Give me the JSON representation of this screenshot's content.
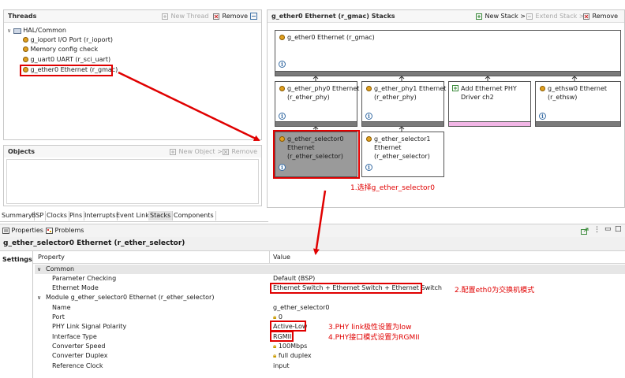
{
  "threads": {
    "title": "Threads",
    "new_thread": "New Thread",
    "remove": "Remove",
    "tree": {
      "root": "HAL/Common",
      "items": [
        "g_ioport I/O Port (r_ioport)",
        "Memory config check",
        "g_uart0 UART (r_sci_uart)",
        "g_ether0 Ethernet (r_gmac)"
      ]
    }
  },
  "objects": {
    "title": "Objects",
    "new_object": "New Object >",
    "remove": "Remove"
  },
  "stacks": {
    "title": "g_ether0 Ethernet (r_gmac) Stacks",
    "new_stack": "New Stack >",
    "extend_stack": "Extend Stack >",
    "remove": "Remove",
    "top_box": "g_ether0 Ethernet (r_gmac)",
    "row2": [
      {
        "line1": "g_ether_phy0 Ethernet",
        "line2": "(r_ether_phy)"
      },
      {
        "line1": "g_ether_phy1 Ethernet",
        "line2": "(r_ether_phy)"
      },
      {
        "line1": "Add Ethernet PHY",
        "line2": "Driver ch2"
      },
      {
        "line1": "g_ethsw0 Ethernet",
        "line2": "(r_ethsw)"
      }
    ],
    "row3": [
      {
        "line1": "g_ether_selector0",
        "line2": "Ethernet",
        "line3": "(r_ether_selector)"
      },
      {
        "line1": "g_ether_selector1",
        "line2": "Ethernet",
        "line3": "(r_ether_selector)"
      }
    ],
    "info_glyph": "i"
  },
  "annotations": {
    "a1": "1.选择g_ether_selector0",
    "a2": "2.配置eth0为交换机模式",
    "a3": "3.PHY link极性设置为low",
    "a4": "4.PHY接口模式设置为RGMII"
  },
  "bottom_tabs": [
    "Summary",
    "BSP",
    "Clocks",
    "Pins",
    "Interrupts",
    "Event Links",
    "Stacks",
    "Components"
  ],
  "props_view": {
    "tabs": [
      "Properties",
      "Problems"
    ],
    "title": "g_ether_selector0 Ethernet (r_ether_selector)",
    "side_tab": "Settings",
    "col_property": "Property",
    "col_value": "Value",
    "rows": [
      {
        "k": "Common",
        "v": "",
        "group": true
      },
      {
        "k": "Parameter Checking",
        "v": "Default (BSP)"
      },
      {
        "k": "Ethernet Mode",
        "v": "Ethernet Switch + Ethernet Switch + Ethernet Switch"
      },
      {
        "k": "Module g_ether_selector0 Ethernet (r_ether_selector)",
        "v": "",
        "group": true
      },
      {
        "k": "Name",
        "v": "g_ether_selector0"
      },
      {
        "k": "Port",
        "v": "0",
        "lock": true
      },
      {
        "k": "PHY Link Signal Polarity",
        "v": "Active-Low"
      },
      {
        "k": "Interface Type",
        "v": "RGMII"
      },
      {
        "k": "Converter Speed",
        "v": "100Mbps",
        "lock": true
      },
      {
        "k": "Converter Duplex",
        "v": "full duplex",
        "lock": true
      },
      {
        "k": "Reference Clock",
        "v": "input"
      }
    ]
  },
  "colors": {
    "annotation": "#e00000",
    "selected_box": "#9a9a9a",
    "pink_bar": "#f2b6e6"
  }
}
